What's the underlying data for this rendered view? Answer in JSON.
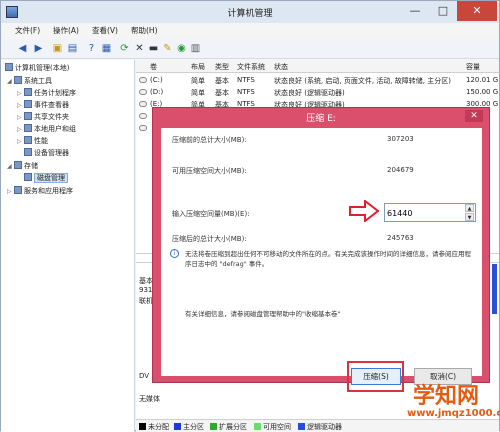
{
  "window": {
    "title": "计算机管理",
    "minimize": "—",
    "maximize": "□",
    "close": "✕"
  },
  "menu": [
    "文件(F)",
    "操作(A)",
    "查看(V)",
    "帮助(H)"
  ],
  "toolbar_icons": [
    "back-icon",
    "forward-icon",
    "up-icon",
    "show-tree-icon",
    "help-icon",
    "properties-icon",
    "refresh-icon",
    "delete-icon",
    "export-icon",
    "settings-icon",
    "disk-icon",
    "view-icon"
  ],
  "tree": {
    "root": "计算机管理(本地)",
    "items": [
      {
        "label": "系统工具",
        "level": 1
      },
      {
        "label": "任务计划程序",
        "level": 2
      },
      {
        "label": "事件查看器",
        "level": 2
      },
      {
        "label": "共享文件夹",
        "level": 2
      },
      {
        "label": "本地用户和组",
        "level": 2
      },
      {
        "label": "性能",
        "level": 2
      },
      {
        "label": "设备管理器",
        "level": 2
      },
      {
        "label": "存储",
        "level": 1
      },
      {
        "label": "磁盘管理",
        "level": 2,
        "selected": true
      },
      {
        "label": "服务和应用程序",
        "level": 1
      }
    ]
  },
  "volumes": {
    "headers": [
      "卷",
      "布局",
      "类型",
      "文件系统",
      "状态",
      "容量"
    ],
    "rows": [
      {
        "vol": "(C:)",
        "layout": "简单",
        "type": "基本",
        "fs": "NTFS",
        "status": "状态良好 (系统, 启动, 页面文件, 活动, 故障转储, 主分区)",
        "cap": "120.01 G"
      },
      {
        "vol": "(D:)",
        "layout": "简单",
        "type": "基本",
        "fs": "NTFS",
        "status": "状态良好 (逻辑驱动器)",
        "cap": "150.00 G"
      },
      {
        "vol": "(E:)",
        "layout": "简单",
        "type": "基本",
        "fs": "NTFS",
        "status": "状态良好 (逻辑驱动器)",
        "cap": "300.00 G"
      },
      {
        "vol": "",
        "layout": "",
        "type": "",
        "fs": "",
        "status": "",
        "cap": ""
      },
      {
        "vol": "",
        "layout": "",
        "type": "",
        "fs": "",
        "status": "",
        "cap": ""
      }
    ]
  },
  "lower": {
    "basic_label": "基本",
    "size_frag": "931",
    "status_frag": "联机",
    "dvd_label": "DV",
    "no_media": "无媒体"
  },
  "legend": [
    {
      "label": "未分配",
      "color": "#000000"
    },
    {
      "label": "主分区",
      "color": "#1d3bd1"
    },
    {
      "label": "扩展分区",
      "color": "#2ea82e"
    },
    {
      "label": "可用空间",
      "color": "#6bdc6b"
    },
    {
      "label": "逻辑驱动器",
      "color": "#2a4ed4"
    }
  ],
  "dialog": {
    "title": "压缩 E:",
    "close": "✕",
    "total_before_label": "压缩前的总计大小(MB):",
    "total_before": "307203",
    "available_label": "可用压缩空间大小(MB):",
    "available": "204679",
    "input_label": "输入压缩空间量(MB)(E):",
    "input_value": "61440",
    "total_after_label": "压缩后的总计大小(MB):",
    "total_after": "245763",
    "info_text": "无法将卷压缩到超出任何不可移动的文件所在的点。有关完成该操作时间的详细信息，请参阅应用程序日志中的 \"defrag\" 事件。",
    "help_text": "有关详细信息，请参阅磁盘管理帮助中的\"收缩基本卷\"",
    "shrink_button": "压缩(S)",
    "cancel_button": "取消(C)"
  },
  "watermark": {
    "big": "学知网",
    "small": "www.jmqz1000.com"
  }
}
